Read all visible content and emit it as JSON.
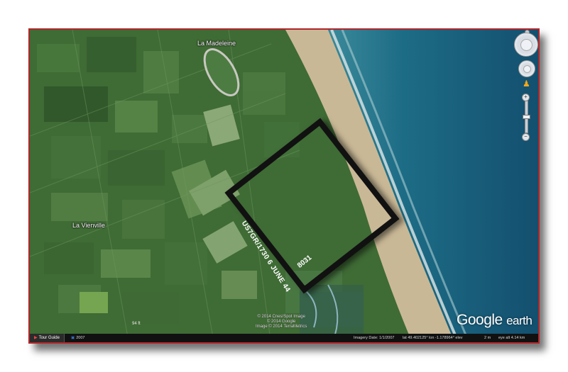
{
  "map": {
    "place_labels": {
      "la_madeleine": "La Madeleine",
      "la_vienville": "La Vienville"
    },
    "scale": "94 ft",
    "copyright": [
      "© 2014 Cnes/Spot Image",
      "© 2014 Google",
      "Image © 2014 TerraMetrics"
    ],
    "brand": {
      "google": "Google",
      "earth": "earth"
    }
  },
  "overlay": {
    "stamp": "US7GR/1730 6 JUNE 44",
    "number": "8031",
    "border_color": "#111111"
  },
  "statusbar": {
    "tour_guide": "Tour Guide",
    "history_year": "2007",
    "imagery_date": "Imagery Date: 1/1/2007",
    "coords": "lat  49.402125°  lon  -1.178964°  elev",
    "elev": "2 m",
    "eye_alt": "eye alt   4.14 km"
  },
  "nav": {
    "icons": [
      "look-joystick-icon",
      "move-joystick-icon",
      "street-view-pegman-icon",
      "zoom-in-icon",
      "zoom-out-icon"
    ],
    "zoom_in": "+",
    "zoom_out": "−"
  },
  "colors": {
    "frame_border": "#b0262a",
    "land": "#3d6a34",
    "beach": "#c8b898",
    "sea": "#1b5e7a"
  }
}
